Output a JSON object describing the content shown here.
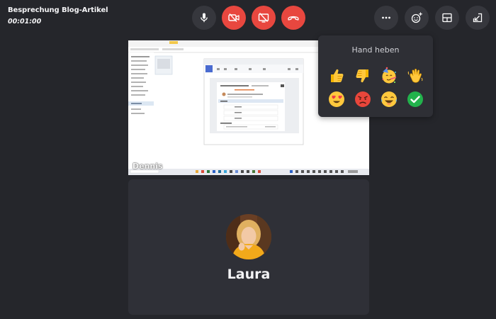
{
  "meeting": {
    "title": "Besprechung Blog-Artikel",
    "timer": "00:01:00"
  },
  "controls": {
    "mic_icon": "microphone-icon",
    "camera_icon": "camera-off-icon",
    "screen_icon": "screen-share-off-icon",
    "hangup_icon": "hang-up-icon",
    "more_icon": "more-dots-icon",
    "reaction_icon": "emoji-add-icon",
    "layout_icon": "layout-icon",
    "minimize_icon": "minimize-icon",
    "red_color": "#e8473f",
    "dark_color": "#36373d"
  },
  "screen_share": {
    "presenter": "Dennis"
  },
  "participant": {
    "name": "Laura"
  },
  "reactions": {
    "title": "Hand heben",
    "items": [
      "thumbs-up",
      "thumbs-down",
      "party-face",
      "waving-hand",
      "heart-eyes",
      "angry-face",
      "laughing-face",
      "check-mark"
    ]
  }
}
